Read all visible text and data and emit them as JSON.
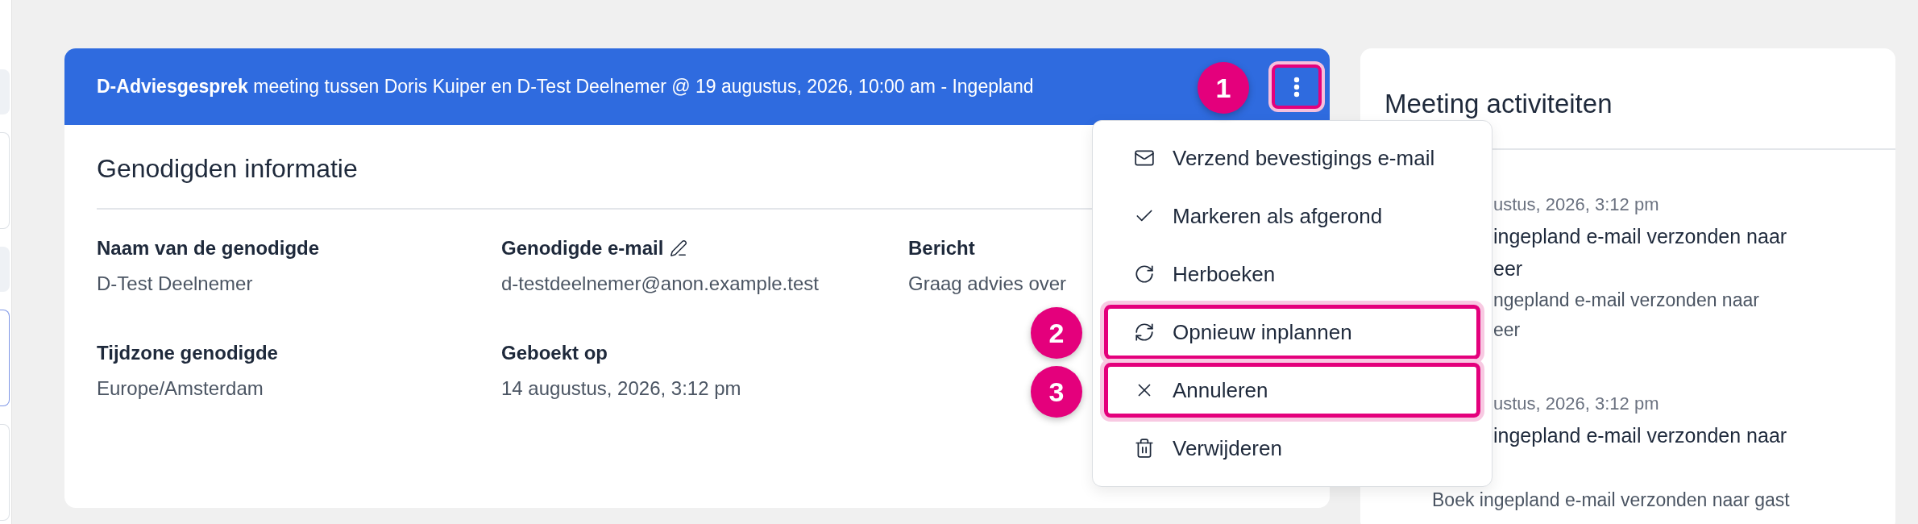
{
  "sidebar": {
    "cards": [
      {
        "kind": "filled"
      },
      {
        "kind": "outlined"
      },
      {
        "kind": "filled"
      },
      {
        "kind": "active"
      },
      {
        "kind": "outlined"
      }
    ]
  },
  "meeting": {
    "header": {
      "title": "**D-Adviesgesprek** meeting tussen Doris Kuiper en D-Test Deelnemer @ 19 augustus, 2026, 10:00 am - Ingepland",
      "menu_button": {
        "highlighted": true
      }
    },
    "section_title": "Genodigden informatie",
    "fields": [
      {
        "label": "Naam van de genodigde",
        "value": "D-Test Deelnemer",
        "editable": false
      },
      {
        "label": "Genodigde e-mail",
        "value": "d-testdeelnemer@anon.example.test",
        "editable": true
      },
      {
        "label": "Bericht",
        "value": "Graag advies over",
        "editable": false
      },
      {
        "label": "Tijdzone genodigde",
        "value": "Europe/Amsterdam",
        "editable": false
      },
      {
        "label": "Geboekt op",
        "value": "14 augustus, 2026, 3:12 pm",
        "editable": false
      }
    ]
  },
  "menu": {
    "items": [
      {
        "kind": "mail",
        "label": "Verzend bevestigings e-mail",
        "highlighted": false
      },
      {
        "kind": "check",
        "label": "Markeren als afgerond",
        "highlighted": false
      },
      {
        "kind": "rebook",
        "label": "Herboeken",
        "highlighted": false
      },
      {
        "kind": "reschedule",
        "label": "Opnieuw inplannen",
        "highlighted": true
      },
      {
        "kind": "cancel",
        "label": "Annuleren",
        "highlighted": true
      },
      {
        "kind": "delete",
        "label": "Verwijderen",
        "highlighted": false
      }
    ]
  },
  "annotations": [
    {
      "number": "1"
    },
    {
      "number": "2"
    },
    {
      "number": "3"
    }
  ],
  "activities": {
    "title": "Meeting activiteiten",
    "entries": [
      {
        "date": "ustus, 2026, 3:12 pm",
        "title_lines": [
          "ingepland e-mail verzonden naar",
          "eer"
        ],
        "description_lines": [
          {
            "kind": "partial",
            "text": "ngepland e-mail verzonden naar"
          },
          {
            "kind": "partial",
            "text": "eer"
          }
        ]
      },
      {
        "date": "ustus, 2026, 3:12 pm",
        "title_lines": [
          "ingepland e-mail verzonden naar"
        ],
        "description_lines": [
          {
            "kind": "full",
            "text": "Boek ingepland e-mail verzonden naar gast"
          }
        ]
      }
    ]
  }
}
